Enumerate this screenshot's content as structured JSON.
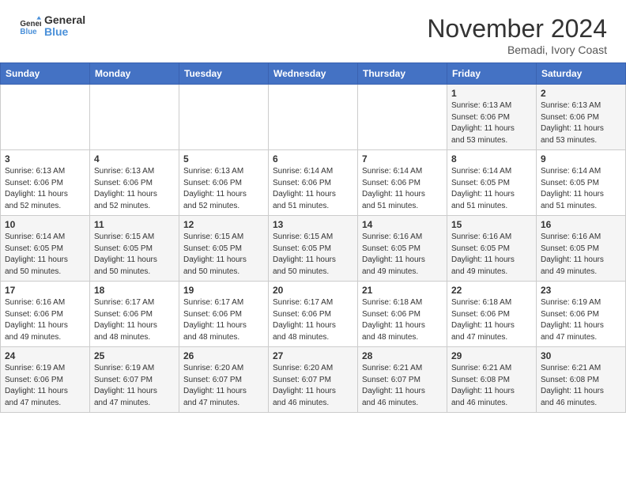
{
  "header": {
    "logo_line1": "General",
    "logo_line2": "Blue",
    "month": "November 2024",
    "location": "Bemadi, Ivory Coast"
  },
  "weekdays": [
    "Sunday",
    "Monday",
    "Tuesday",
    "Wednesday",
    "Thursday",
    "Friday",
    "Saturday"
  ],
  "weeks": [
    [
      {
        "day": "",
        "info": ""
      },
      {
        "day": "",
        "info": ""
      },
      {
        "day": "",
        "info": ""
      },
      {
        "day": "",
        "info": ""
      },
      {
        "day": "",
        "info": ""
      },
      {
        "day": "1",
        "info": "Sunrise: 6:13 AM\nSunset: 6:06 PM\nDaylight: 11 hours\nand 53 minutes."
      },
      {
        "day": "2",
        "info": "Sunrise: 6:13 AM\nSunset: 6:06 PM\nDaylight: 11 hours\nand 53 minutes."
      }
    ],
    [
      {
        "day": "3",
        "info": "Sunrise: 6:13 AM\nSunset: 6:06 PM\nDaylight: 11 hours\nand 52 minutes."
      },
      {
        "day": "4",
        "info": "Sunrise: 6:13 AM\nSunset: 6:06 PM\nDaylight: 11 hours\nand 52 minutes."
      },
      {
        "day": "5",
        "info": "Sunrise: 6:13 AM\nSunset: 6:06 PM\nDaylight: 11 hours\nand 52 minutes."
      },
      {
        "day": "6",
        "info": "Sunrise: 6:14 AM\nSunset: 6:06 PM\nDaylight: 11 hours\nand 51 minutes."
      },
      {
        "day": "7",
        "info": "Sunrise: 6:14 AM\nSunset: 6:06 PM\nDaylight: 11 hours\nand 51 minutes."
      },
      {
        "day": "8",
        "info": "Sunrise: 6:14 AM\nSunset: 6:05 PM\nDaylight: 11 hours\nand 51 minutes."
      },
      {
        "day": "9",
        "info": "Sunrise: 6:14 AM\nSunset: 6:05 PM\nDaylight: 11 hours\nand 51 minutes."
      }
    ],
    [
      {
        "day": "10",
        "info": "Sunrise: 6:14 AM\nSunset: 6:05 PM\nDaylight: 11 hours\nand 50 minutes."
      },
      {
        "day": "11",
        "info": "Sunrise: 6:15 AM\nSunset: 6:05 PM\nDaylight: 11 hours\nand 50 minutes."
      },
      {
        "day": "12",
        "info": "Sunrise: 6:15 AM\nSunset: 6:05 PM\nDaylight: 11 hours\nand 50 minutes."
      },
      {
        "day": "13",
        "info": "Sunrise: 6:15 AM\nSunset: 6:05 PM\nDaylight: 11 hours\nand 50 minutes."
      },
      {
        "day": "14",
        "info": "Sunrise: 6:16 AM\nSunset: 6:05 PM\nDaylight: 11 hours\nand 49 minutes."
      },
      {
        "day": "15",
        "info": "Sunrise: 6:16 AM\nSunset: 6:05 PM\nDaylight: 11 hours\nand 49 minutes."
      },
      {
        "day": "16",
        "info": "Sunrise: 6:16 AM\nSunset: 6:05 PM\nDaylight: 11 hours\nand 49 minutes."
      }
    ],
    [
      {
        "day": "17",
        "info": "Sunrise: 6:16 AM\nSunset: 6:06 PM\nDaylight: 11 hours\nand 49 minutes."
      },
      {
        "day": "18",
        "info": "Sunrise: 6:17 AM\nSunset: 6:06 PM\nDaylight: 11 hours\nand 48 minutes."
      },
      {
        "day": "19",
        "info": "Sunrise: 6:17 AM\nSunset: 6:06 PM\nDaylight: 11 hours\nand 48 minutes."
      },
      {
        "day": "20",
        "info": "Sunrise: 6:17 AM\nSunset: 6:06 PM\nDaylight: 11 hours\nand 48 minutes."
      },
      {
        "day": "21",
        "info": "Sunrise: 6:18 AM\nSunset: 6:06 PM\nDaylight: 11 hours\nand 48 minutes."
      },
      {
        "day": "22",
        "info": "Sunrise: 6:18 AM\nSunset: 6:06 PM\nDaylight: 11 hours\nand 47 minutes."
      },
      {
        "day": "23",
        "info": "Sunrise: 6:19 AM\nSunset: 6:06 PM\nDaylight: 11 hours\nand 47 minutes."
      }
    ],
    [
      {
        "day": "24",
        "info": "Sunrise: 6:19 AM\nSunset: 6:06 PM\nDaylight: 11 hours\nand 47 minutes."
      },
      {
        "day": "25",
        "info": "Sunrise: 6:19 AM\nSunset: 6:07 PM\nDaylight: 11 hours\nand 47 minutes."
      },
      {
        "day": "26",
        "info": "Sunrise: 6:20 AM\nSunset: 6:07 PM\nDaylight: 11 hours\nand 47 minutes."
      },
      {
        "day": "27",
        "info": "Sunrise: 6:20 AM\nSunset: 6:07 PM\nDaylight: 11 hours\nand 46 minutes."
      },
      {
        "day": "28",
        "info": "Sunrise: 6:21 AM\nSunset: 6:07 PM\nDaylight: 11 hours\nand 46 minutes."
      },
      {
        "day": "29",
        "info": "Sunrise: 6:21 AM\nSunset: 6:08 PM\nDaylight: 11 hours\nand 46 minutes."
      },
      {
        "day": "30",
        "info": "Sunrise: 6:21 AM\nSunset: 6:08 PM\nDaylight: 11 hours\nand 46 minutes."
      }
    ]
  ]
}
